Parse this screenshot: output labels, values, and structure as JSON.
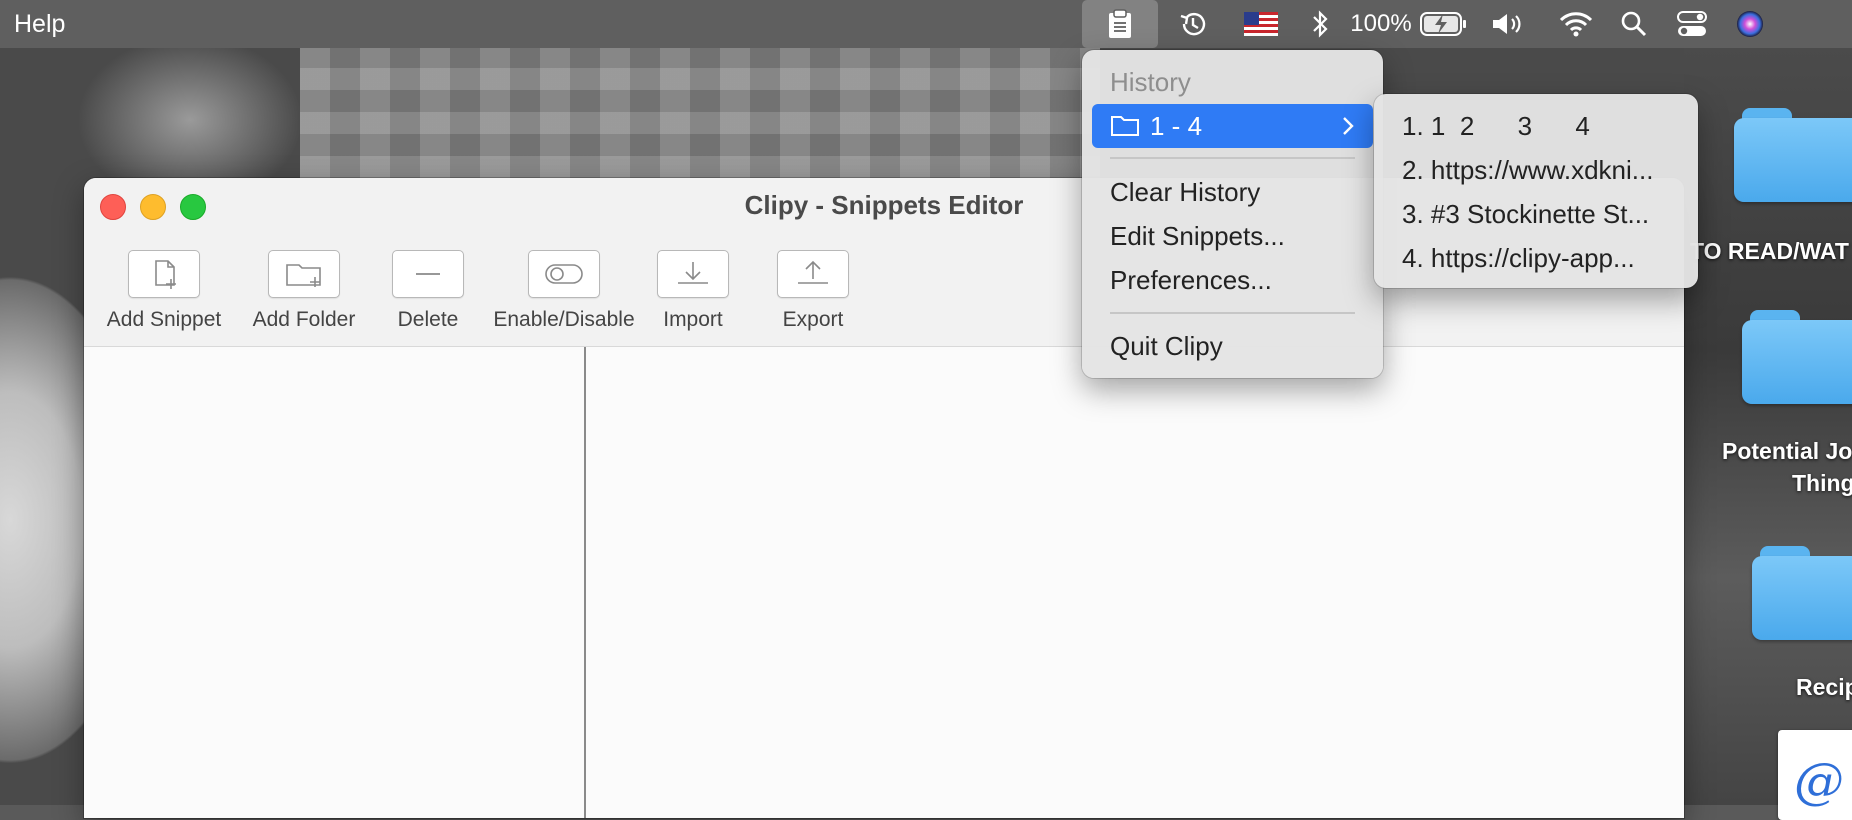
{
  "menubar": {
    "app_menu": "Help",
    "battery_percent": "100%"
  },
  "desktop": {
    "items": [
      {
        "label": "TO READ/WAT"
      },
      {
        "label_line1": "Potential Jo",
        "label_line2": "Things"
      },
      {
        "label": "Recipes"
      }
    ],
    "doc_glyph": "@"
  },
  "window": {
    "title": "Clipy - Snippets Editor",
    "toolbar": [
      {
        "label": "Add Snippet",
        "icon": "add-snippet-icon"
      },
      {
        "label": "Add Folder",
        "icon": "add-folder-icon"
      },
      {
        "label": "Delete",
        "icon": "minus-icon"
      },
      {
        "label": "Enable/Disable",
        "icon": "toggle-icon"
      },
      {
        "label": "Import",
        "icon": "import-icon"
      },
      {
        "label": "Export",
        "icon": "export-icon"
      }
    ]
  },
  "clipy_menu": {
    "header": "History",
    "group": "1 - 4",
    "items": [
      "Clear History",
      "Edit Snippets...",
      "Preferences...",
      "Quit Clipy"
    ]
  },
  "history_submenu": {
    "items": [
      "1. 1  2      3      4",
      "2. https://www.xdkni...",
      "3. #3 Stockinette St...",
      "4. https://clipy-app..."
    ]
  },
  "colors": {
    "menu_highlight": "#2f7bf5",
    "close": "#fe5f57",
    "minimize": "#febc2e",
    "maximize": "#28c840",
    "folder": "#5ab4f0"
  }
}
